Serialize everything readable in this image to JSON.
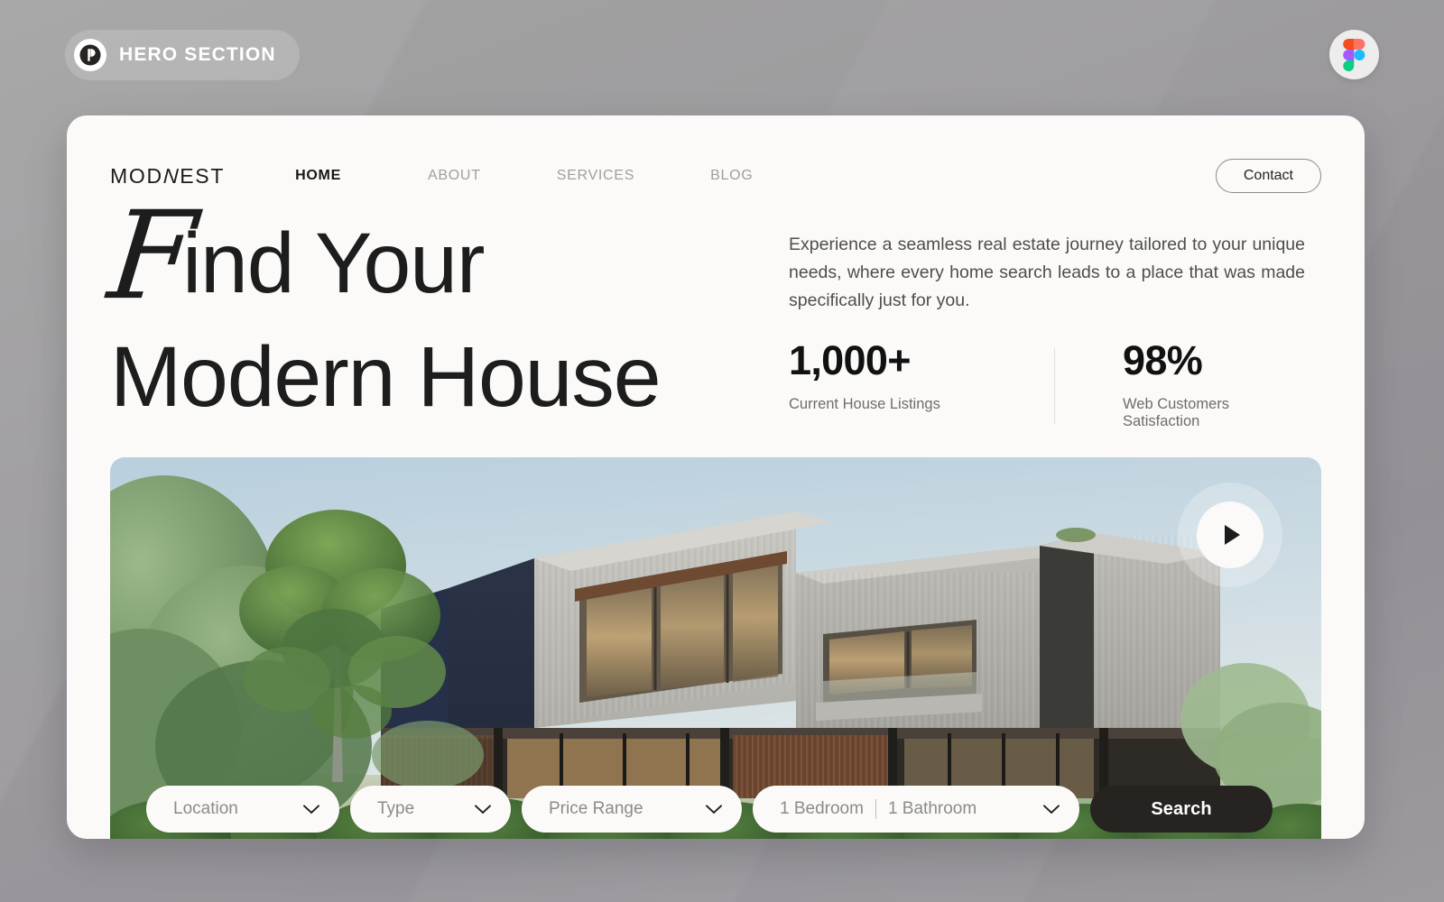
{
  "badge": {
    "label": "HERO SECTION",
    "logo_icon": "prototype-circle-icon"
  },
  "figma_button": {
    "icon": "figma-logo-icon"
  },
  "nav": {
    "brand": "MOD",
    "brand_slant": "N",
    "brand_tail": "EST",
    "links": [
      {
        "label": "HOME",
        "active": true
      },
      {
        "label": "ABOUT",
        "active": false
      },
      {
        "label": "SERVICES",
        "active": false
      },
      {
        "label": "BLOG",
        "active": false
      }
    ],
    "contact_label": "Contact"
  },
  "hero": {
    "headline_initial": "F",
    "headline_line1_rest": "ind Your",
    "headline_line2": "Modern House",
    "intro": "Experience a seamless real estate journey tailored to your unique needs, where every home search leads to a place that was made specifically just for you.",
    "stats": [
      {
        "value": "1,000+",
        "label": "Current House Listings"
      },
      {
        "value": "98%",
        "label": "Web Customers Satisfaction"
      }
    ],
    "play_button_icon": "play-icon",
    "image_alt": "modern-house-photo"
  },
  "search": {
    "location": {
      "value": "Location",
      "icon": "chevron-down-icon"
    },
    "type": {
      "value": "Type",
      "icon": "chevron-down-icon"
    },
    "price": {
      "value": "Price Range",
      "icon": "chevron-down-icon"
    },
    "rooms": {
      "bedroom": "1 Bedroom",
      "bathroom": "1 Bathroom",
      "icon": "chevron-down-icon"
    },
    "submit_label": "Search"
  },
  "colors": {
    "canvas": "#9b9b9b",
    "card": "#fbfaf8",
    "ink": "#1d1d1d",
    "muted": "#8b8b89",
    "dark_button": "#262321"
  }
}
